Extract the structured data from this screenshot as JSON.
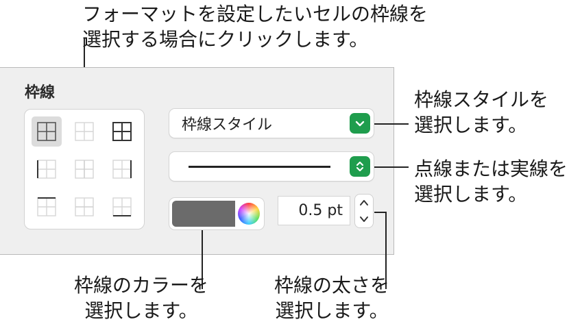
{
  "callouts": {
    "top": [
      "フォーマットを設定したいセルの枠線を",
      "選択する場合にクリックします。"
    ],
    "style": [
      "枠線スタイルを",
      "選択します。"
    ],
    "dash": [
      "点線または実線を",
      "選択します。"
    ],
    "color": [
      "枠線のカラーを",
      "選択します。"
    ],
    "width": [
      "枠線の太さを",
      "選択します。"
    ]
  },
  "panel": {
    "section_title": "枠線",
    "border_style_popup": "枠線スタイル",
    "line_type": "solid",
    "stroke_color": "#6b6b6b",
    "stroke_width": "0.5 pt",
    "border_buttons": [
      "all-borders",
      "inside-borders",
      "outside-borders",
      "left-border",
      "vertical-inside-border",
      "right-border",
      "top-border",
      "horizontal-inside-border",
      "bottom-border"
    ],
    "selected_border_button": "all-borders"
  },
  "colors": {
    "accent_green": "#1f9d4d",
    "panel_bg": "#efefef"
  }
}
